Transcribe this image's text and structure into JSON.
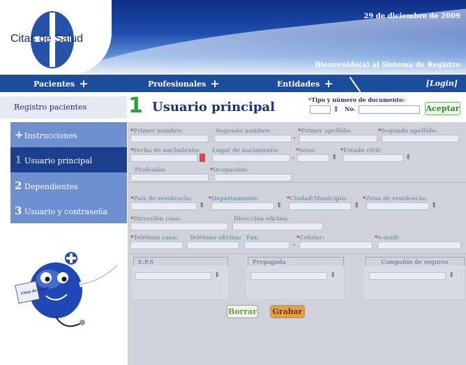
{
  "header": {
    "logo_text": "Citas de Salud",
    "date": "29 de diciembre de 2009",
    "welcome": "Bienvenido(a) al Sistema de Registro"
  },
  "nav": {
    "items": [
      "Pacientes",
      "Profesionales",
      "Entidades"
    ],
    "plus": "+",
    "login": "[Login]"
  },
  "subheader": {
    "section_title": "Registro pacientes",
    "step_number": "1",
    "page_title": "Usuario principal",
    "doc_label_req": "*",
    "doc_label": "Tipo y número de documento:",
    "doc_no_label": "No.",
    "accept_button": "Aceptar"
  },
  "sidebar": {
    "items": [
      {
        "icon": "+",
        "label": "Instrucciones"
      },
      {
        "icon": "1",
        "label": "Usuario principal",
        "active": true
      },
      {
        "icon": "2",
        "label": "Dependientes"
      },
      {
        "icon": "3",
        "label": "Usuario y contraseña"
      }
    ]
  },
  "mascot": {
    "badge_text": "Citas de Salud"
  },
  "form": {
    "row1": {
      "primer_nombre": "Primer nombre:",
      "segundo_nombre": "Segundo nombre:",
      "primer_apellido": "Primer apellido:",
      "segundo_apellido": "Segundo apellido:"
    },
    "row2": {
      "fecha_nacimiento": "Fecha de nacimiento:",
      "lugar_nacimiento": "Lugar de nacimiento:",
      "sexo": "Sexo:",
      "estado_civil": "Estado civil:"
    },
    "row3": {
      "profesion": "Profesión:",
      "ocupacion": "Ocupación:"
    },
    "row4": {
      "pais": "País de residencia:",
      "departamento": "Departamento:",
      "ciudad": "Ciudad/Municipio:",
      "zona": "Zona de residencia:"
    },
    "row5": {
      "dir_casa": "Dirección casa:",
      "dir_oficina": "Dirección oficina:"
    },
    "row6": {
      "tel_casa": "Teléfono casa:",
      "tel_oficina": "Teléfono oficina:",
      "fax": "Fax:",
      "celular": "Celular:",
      "email": "e-mail:"
    },
    "groups": {
      "eps": "E.P.S",
      "prepagada": "Prepagada",
      "compania": "Compañía de seguros"
    },
    "req": "*",
    "dash": "–",
    "spin": "⇕",
    "buttons": {
      "borrar": "Borrar",
      "grabar": "Grabar"
    }
  },
  "colors": {
    "nav": "#1c4c9c",
    "sidebar": "#6e8fd0",
    "sidebar_active": "#1c3f8e",
    "accent_green": "#2aa037",
    "grabar": "#e3a04a"
  }
}
